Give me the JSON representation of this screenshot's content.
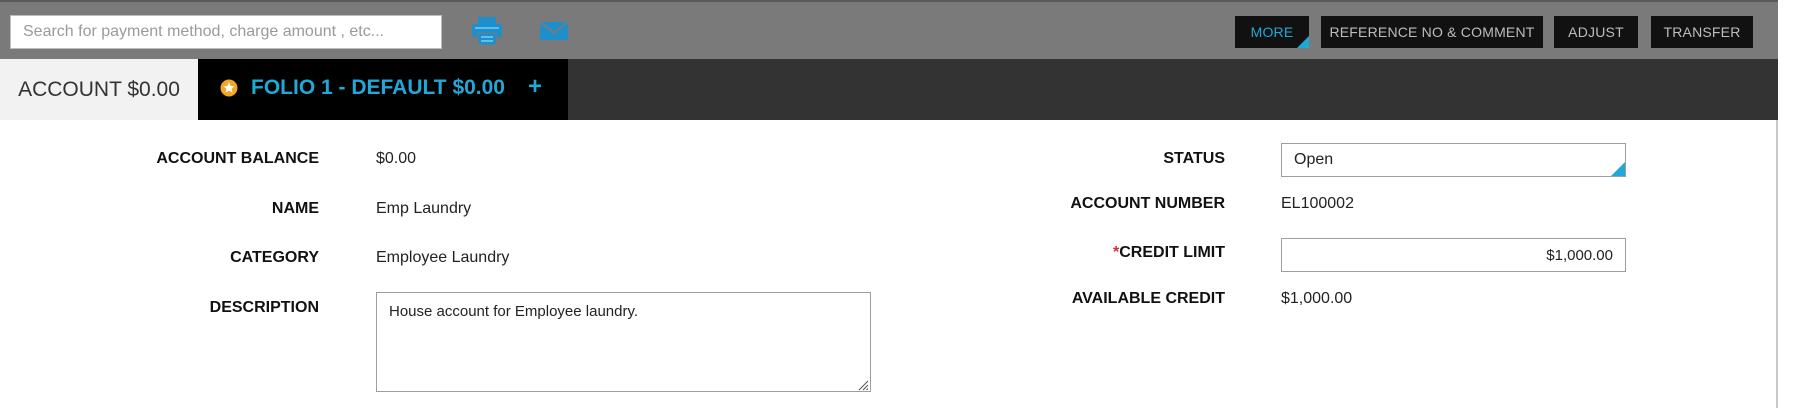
{
  "toolbar": {
    "search_placeholder": "Search for payment method, charge amount , etc...",
    "buttons": {
      "more": "MORE",
      "reference": "REFERENCE NO & COMMENT",
      "adjust": "ADJUST",
      "transfer": "TRANSFER"
    },
    "icons": [
      "printer-icon",
      "mail-icon"
    ]
  },
  "tabs": {
    "account": "ACCOUNT $0.00",
    "folio": "FOLIO 1 - DEFAULT $0.00",
    "add": "+"
  },
  "form": {
    "left": {
      "account_balance_label": "ACCOUNT BALANCE",
      "account_balance_value": "$0.00",
      "name_label": "NAME",
      "name_value": "Emp Laundry",
      "category_label": "CATEGORY",
      "category_value": "Employee Laundry",
      "description_label": "DESCRIPTION",
      "description_value": "House account for Employee laundry."
    },
    "right": {
      "status_label": "STATUS",
      "status_value": "Open",
      "account_number_label": "ACCOUNT NUMBER",
      "account_number_value": "EL100002",
      "credit_limit_required": "*",
      "credit_limit_label": "CREDIT LIMIT",
      "credit_limit_value": "$1,000.00",
      "available_credit_label": "AVAILABLE CREDIT",
      "available_credit_value": "$1,000.00"
    }
  },
  "colors": {
    "accent": "#20a8d8",
    "toolbar_bg": "#7a7a7a",
    "tabbar_bg": "#333333",
    "button_bg": "#111111",
    "required": "#d32f2f"
  }
}
